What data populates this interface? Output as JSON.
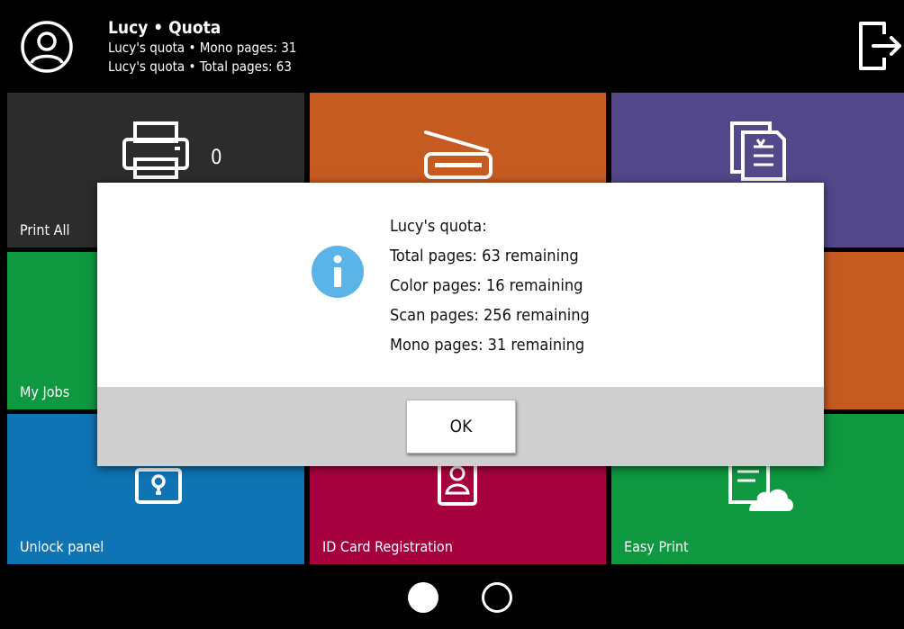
{
  "header": {
    "title": "Lucy • Quota",
    "quota_lines": [
      "Lucy's quota • Mono pages: 31",
      "Lucy's quota • Total pages: 63"
    ],
    "avatar_icon": "user-circle-icon",
    "logout_icon": "logout-icon"
  },
  "tiles": [
    {
      "label": "Print All",
      "icon": "printer-icon",
      "count": "0",
      "color": "#2c2c2c"
    },
    {
      "label": "",
      "icon": "scanner-icon",
      "color": "#c65b22"
    },
    {
      "label": "",
      "icon": "documents-icon",
      "color": "#53488a"
    },
    {
      "label": "My Jobs",
      "icon": "",
      "color": "#0e9840"
    },
    {
      "label": "",
      "icon": "",
      "color": "#7a2060"
    },
    {
      "label": "",
      "icon": "",
      "color": "#c65b22"
    },
    {
      "label": "Unlock panel",
      "icon": "lock-icon",
      "color": "#0e74b4"
    },
    {
      "label": "ID Card Registration",
      "icon": "id-card-icon",
      "color": "#a7003e"
    },
    {
      "label": "Easy Print",
      "icon": "cloud-document-icon",
      "color": "#0e9840"
    }
  ],
  "dialog": {
    "icon": "info-icon",
    "icon_color": "#5ab4e8",
    "lines": [
      "Lucy's quota:",
      "Total pages: 63 remaining",
      "Color pages: 16 remaining",
      "Scan pages: 256 remaining",
      "Mono pages: 31 remaining"
    ],
    "ok_label": "OK"
  },
  "pager": {
    "pages": 2,
    "current": 1
  }
}
